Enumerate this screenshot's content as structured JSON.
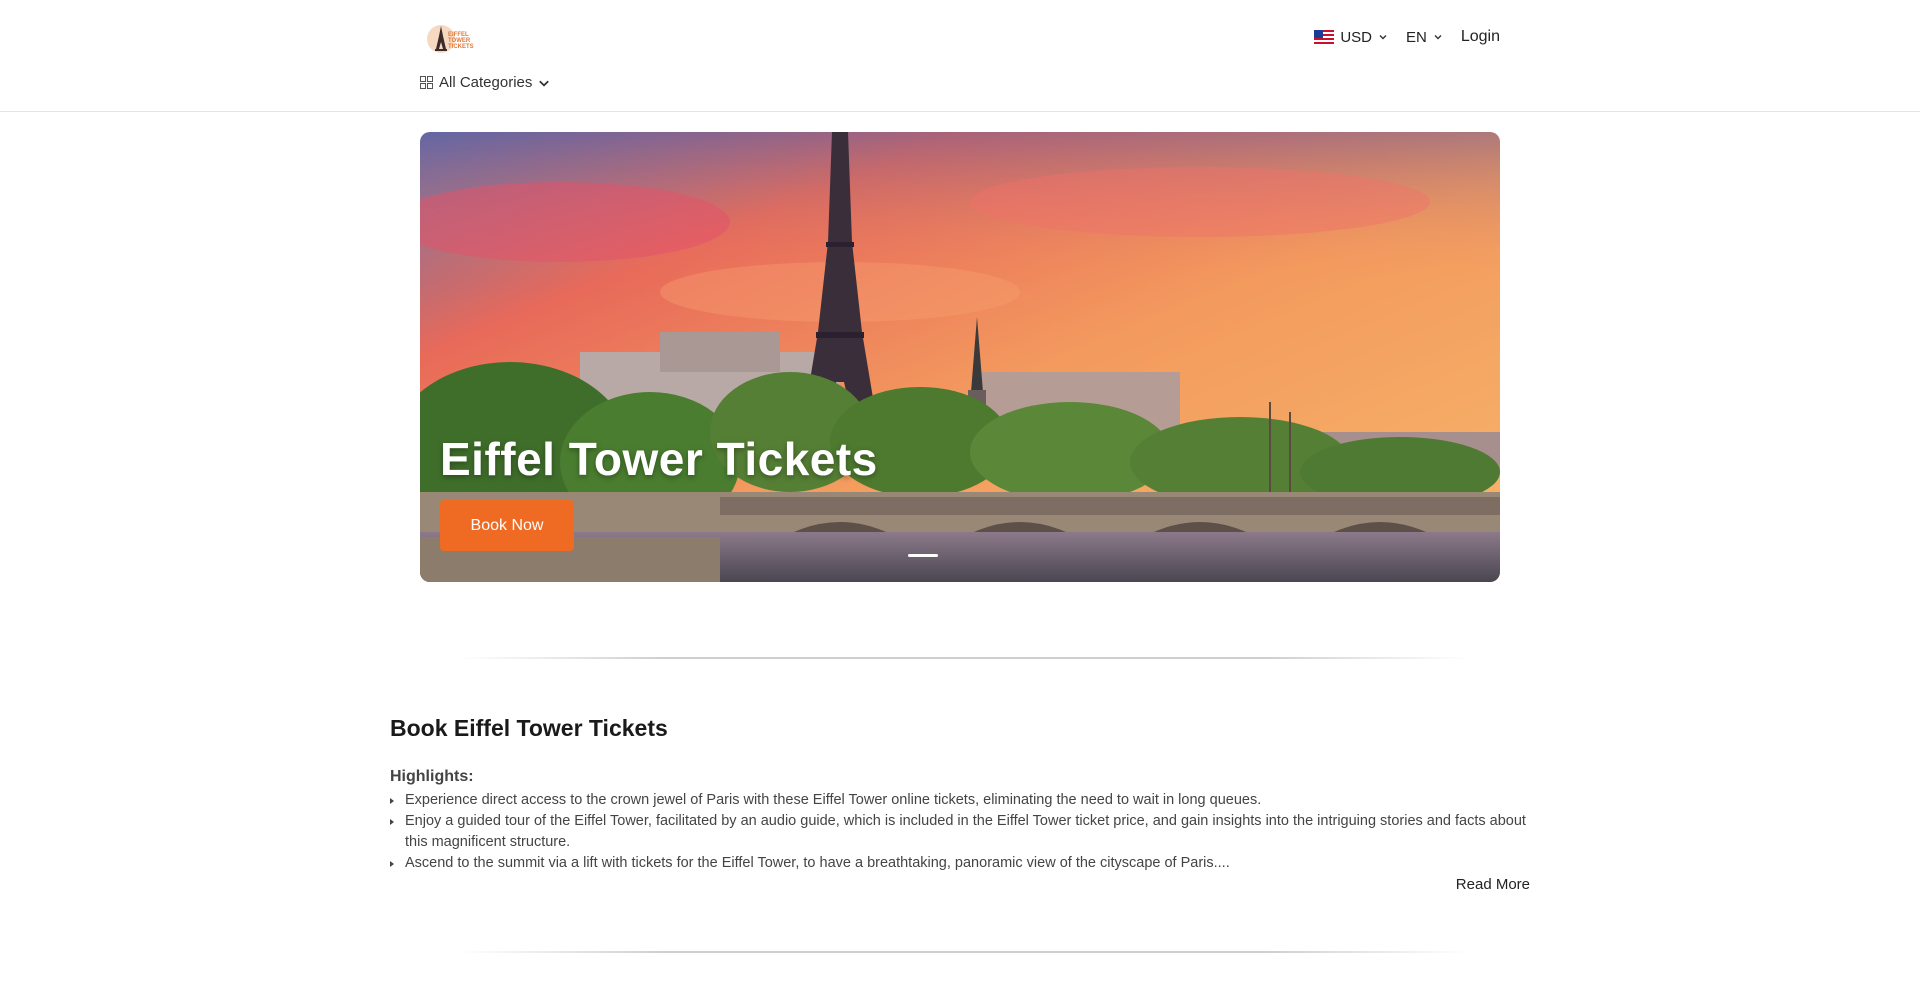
{
  "header": {
    "logo_text": "EIFFEL TOWER TICKETS",
    "currency_label": "USD",
    "language_label": "EN",
    "login_label": "Login",
    "categories_label": "All Categories"
  },
  "hero": {
    "title": "Eiffel Tower Tickets",
    "button_label": "Book Now"
  },
  "content": {
    "title": "Book Eiffel Tower Tickets",
    "highlights_title": "Highlights:",
    "highlights": [
      "Experience direct access to the crown jewel of Paris with these Eiffel Tower online tickets, eliminating the need to wait in long queues.",
      "Enjoy a guided tour of the Eiffel Tower, facilitated by an audio guide, which is included in the Eiffel Tower ticket price, and gain insights into the intriguing stories and facts about this magnificent structure.",
      "Ascend to the summit via a lift with tickets for the Eiffel Tower, to have a breathtaking, panoramic view of the cityscape of Paris...."
    ],
    "read_more_label": "Read More"
  },
  "colors": {
    "accent": "#ef6b24",
    "text": "#222222",
    "divider": "#cfcfcf"
  },
  "icons": {
    "flag": "us-flag-icon",
    "chevron": "chevron-down-icon",
    "categories": "grid-icon"
  }
}
